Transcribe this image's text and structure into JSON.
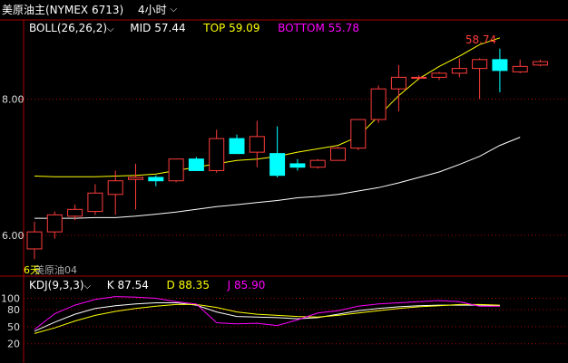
{
  "header": {
    "title": "美原油主(NYMEX 6713)",
    "period": "4小时"
  },
  "colors": {
    "up": "#ff3c3c",
    "down": "#00ffff",
    "mid": "#ffffff",
    "top": "#ffff00",
    "bottom": "#ff00ff",
    "axis": "#aa0000",
    "k_line": "#ffffff",
    "d_line": "#ffff00",
    "j_line": "#ff00ff"
  },
  "boll": {
    "label": "BOLL(26,26,2)",
    "mid_label": "MID",
    "mid_value": "57.44",
    "top_label": "TOP",
    "top_value": "59.09",
    "bottom_label": "BOTTOM",
    "bottom_value": "55.78"
  },
  "kdj": {
    "label": "KDJ(9,3,3)",
    "k_label": "K",
    "k_value": "87.54",
    "d_label": "D",
    "d_value": "88.35",
    "j_label": "J",
    "j_value": "85.90"
  },
  "annotations": {
    "high_label": "58.74",
    "sub_label": "美原油04",
    "left_marker": "6天"
  },
  "chart_data": [
    {
      "type": "candlestick",
      "y_ticks": [
        {
          "value": 56.0,
          "label": "6.00"
        },
        {
          "value": 58.0,
          "label": "8.00"
        }
      ],
      "ylim": [
        55.6,
        58.95
      ],
      "candles": [
        {
          "o": 55.8,
          "h": 56.2,
          "l": 55.65,
          "c": 56.05
        },
        {
          "o": 56.05,
          "h": 56.35,
          "l": 55.95,
          "c": 56.3
        },
        {
          "o": 56.28,
          "h": 56.45,
          "l": 56.22,
          "c": 56.38
        },
        {
          "o": 56.35,
          "h": 56.75,
          "l": 56.3,
          "c": 56.62
        },
        {
          "o": 56.6,
          "h": 56.95,
          "l": 56.3,
          "c": 56.8
        },
        {
          "o": 56.82,
          "h": 57.05,
          "l": 56.38,
          "c": 56.85
        },
        {
          "o": 56.85,
          "h": 56.88,
          "l": 56.72,
          "c": 56.8
        },
        {
          "o": 56.8,
          "h": 57.08,
          "l": 56.78,
          "c": 57.12
        },
        {
          "o": 57.12,
          "h": 57.15,
          "l": 56.95,
          "c": 56.95
        },
        {
          "o": 56.95,
          "h": 57.55,
          "l": 56.92,
          "c": 57.42
        },
        {
          "o": 57.42,
          "h": 57.48,
          "l": 57.2,
          "c": 57.2
        },
        {
          "o": 57.22,
          "h": 57.68,
          "l": 57.0,
          "c": 57.45
        },
        {
          "o": 57.2,
          "h": 57.6,
          "l": 56.85,
          "c": 56.88
        },
        {
          "o": 57.05,
          "h": 57.12,
          "l": 56.95,
          "c": 57.0
        },
        {
          "o": 57.0,
          "h": 57.12,
          "l": 56.98,
          "c": 57.1
        },
        {
          "o": 57.1,
          "h": 57.3,
          "l": 57.1,
          "c": 57.28
        },
        {
          "o": 57.28,
          "h": 57.7,
          "l": 57.25,
          "c": 57.7
        },
        {
          "o": 57.7,
          "h": 58.2,
          "l": 57.65,
          "c": 58.15
        },
        {
          "o": 58.15,
          "h": 58.5,
          "l": 57.82,
          "c": 58.32
        },
        {
          "o": 58.32,
          "h": 58.35,
          "l": 58.28,
          "c": 58.32
        },
        {
          "o": 58.32,
          "h": 58.4,
          "l": 58.28,
          "c": 58.38
        },
        {
          "o": 58.38,
          "h": 58.6,
          "l": 58.32,
          "c": 58.45
        },
        {
          "o": 58.45,
          "h": 58.6,
          "l": 58.0,
          "c": 58.58
        },
        {
          "o": 58.58,
          "h": 58.74,
          "l": 58.1,
          "c": 58.42
        },
        {
          "o": 58.4,
          "h": 58.58,
          "l": 58.38,
          "c": 58.48
        },
        {
          "o": 58.5,
          "h": 58.58,
          "l": 58.48,
          "c": 58.55
        }
      ],
      "series": [
        {
          "values": [
            56.87,
            56.86,
            56.86,
            56.86,
            56.87,
            56.88,
            56.9,
            56.95,
            57.0,
            57.05,
            57.1,
            57.12,
            57.16,
            57.22,
            57.27,
            57.32,
            57.45,
            57.75,
            58.05,
            58.3,
            58.48,
            58.63,
            58.8,
            58.9
          ]
        },
        {
          "values": [
            56.25,
            56.25,
            56.25,
            56.26,
            56.26,
            56.28,
            56.31,
            56.34,
            56.38,
            56.42,
            56.45,
            56.48,
            56.51,
            56.55,
            56.57,
            56.6,
            56.65,
            56.7,
            56.77,
            56.85,
            56.93,
            57.04,
            57.16,
            57.32,
            57.44
          ]
        }
      ]
    },
    {
      "type": "line",
      "y_ticks": [
        100,
        80,
        50,
        20
      ],
      "ylim": [
        10,
        112
      ],
      "series": [
        {
          "values": [
            42,
            58,
            72,
            82,
            87,
            90,
            92,
            92,
            88,
            76,
            68,
            67,
            66,
            64,
            66,
            72,
            78,
            82,
            85,
            87,
            88,
            88,
            88,
            87
          ]
        },
        {
          "values": [
            38,
            48,
            60,
            70,
            77,
            82,
            86,
            89,
            89,
            84,
            76,
            72,
            70,
            68,
            67,
            70,
            74,
            78,
            82,
            85,
            87,
            89,
            89,
            88
          ]
        },
        {
          "values": [
            45,
            73,
            88,
            98,
            103,
            102,
            100,
            94,
            90,
            57,
            55,
            56,
            52,
            62,
            74,
            78,
            86,
            90,
            92,
            94,
            96,
            94,
            86,
            86
          ]
        }
      ]
    }
  ]
}
